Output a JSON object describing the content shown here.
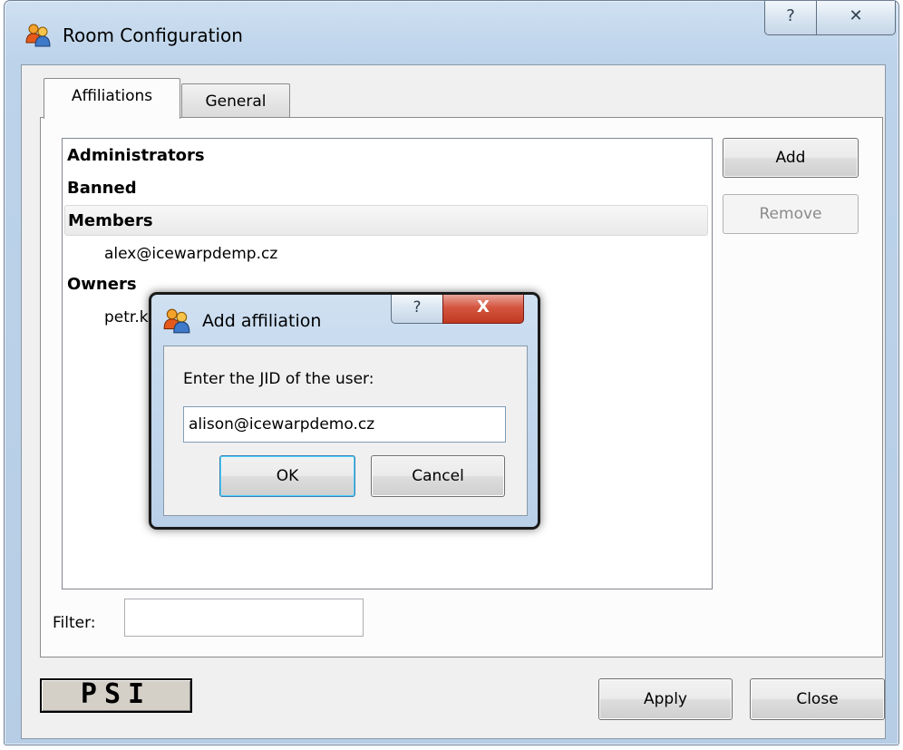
{
  "window": {
    "title": "Room Configuration",
    "help_glyph": "?",
    "close_glyph": "✕"
  },
  "tabs": [
    {
      "label": "Affiliations",
      "active": true
    },
    {
      "label": "General",
      "active": false
    }
  ],
  "tree": {
    "groups": [
      {
        "label": "Administrators",
        "children": []
      },
      {
        "label": "Banned",
        "children": []
      },
      {
        "label": "Members",
        "selected": true,
        "children": [
          "alex@icewarpdemp.cz"
        ]
      },
      {
        "label": "Owners",
        "children": [
          "petr.k"
        ]
      }
    ]
  },
  "side_buttons": {
    "add_label": "Add",
    "remove_label": "Remove"
  },
  "filter": {
    "label": "Filter:",
    "value": ""
  },
  "logo_text": "PSI",
  "footer": {
    "apply_label": "Apply",
    "close_label": "Close"
  },
  "dialog": {
    "title": "Add affiliation",
    "help_glyph": "?",
    "close_glyph": "X",
    "prompt": "Enter the JID of the user:",
    "jid_value": "alison@icewarpdemo.cz",
    "ok_label": "OK",
    "cancel_label": "Cancel"
  },
  "colors": {
    "title_gradient_top": "#cfe0f1",
    "close_button_red": "#c13a22",
    "default_button_focus": "#48d3ff"
  },
  "icons": {
    "app_icon": "users-icon",
    "dialog_icon": "users-icon"
  }
}
